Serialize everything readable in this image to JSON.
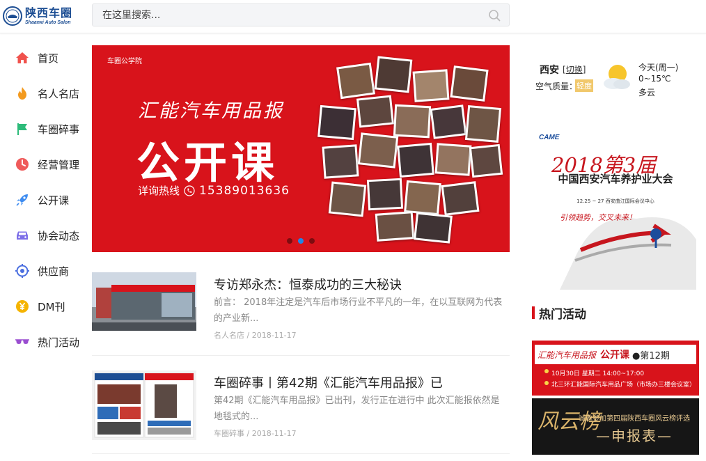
{
  "colors": {
    "brand_red": "#d8131b",
    "brand_blue": "#1d4e93",
    "slider_active": "#1f86e8"
  },
  "header": {
    "logo_cn": "陕西车圈",
    "logo_en": "Shaanxi Auto Salon",
    "search_placeholder": "在这里搜索..."
  },
  "sidebar": {
    "items": [
      {
        "label": "首页",
        "icon": "home-icon"
      },
      {
        "label": "名人名店",
        "icon": "flame-icon"
      },
      {
        "label": "车圈碎事",
        "icon": "flag-icon"
      },
      {
        "label": "经营管理",
        "icon": "clock-icon"
      },
      {
        "label": "公开课",
        "icon": "rocket-icon"
      },
      {
        "label": "协会动态",
        "icon": "car-icon"
      },
      {
        "label": "供应商",
        "icon": "target-icon"
      },
      {
        "label": "DM刊",
        "icon": "yen-coin-icon"
      },
      {
        "label": "热门活动",
        "icon": "sunglasses-icon"
      }
    ]
  },
  "banner": {
    "brand": "车圈公学院",
    "headline_script": "汇能汽车用品报",
    "headline_main": "公开课",
    "hotline_label": "详询热线",
    "hotline_number": "15389013636",
    "slide_count": 3,
    "active_slide": 2
  },
  "articles": [
    {
      "title": "专访郑永杰：恒泰成功的三大秘诀",
      "desc": "前言： 2018年注定是汽车后市场行业不平凡的一年，在以互联网为代表的产业新...",
      "category": "名人名店",
      "date": "2018-11-17"
    },
    {
      "title": "车圈碎事丨第42期《汇能汽车用品报》已",
      "desc": "第42期《汇能汽车用品报》已出刊，发行正在进行中 此次汇能报依然是地毯式的...",
      "category": "车圈碎事",
      "date": "2018-11-17"
    }
  ],
  "weather": {
    "city": "西安",
    "switch_label": "切换",
    "aq_label": "空气质量：",
    "aq_value": "轻度",
    "day": "今天(周一)",
    "temp": "0~15℃",
    "condition": "多云"
  },
  "ad": {
    "org": "CAME",
    "year_line": "2018第3届",
    "conference": "中国西安汽车养护业大会",
    "date_line": "12.25 ~ 27  西安曲江国际会议中心",
    "slogan": "引领趋势，交叉未来！"
  },
  "hot_section": {
    "title": "热门活动",
    "card1": {
      "script": "汇能汽车用品报",
      "label": "公开课",
      "issue": "●第12期",
      "time_line": "10月30日 星期二  14:00~17:00",
      "place_line": "北三环汇能国际汽车用品广场（市场办三楼会议室）"
    },
    "card2": {
      "art": "风云榜",
      "invite": "诚邀参加第四届陕西车圈风云榜评选",
      "apply": "—申报表—"
    }
  }
}
